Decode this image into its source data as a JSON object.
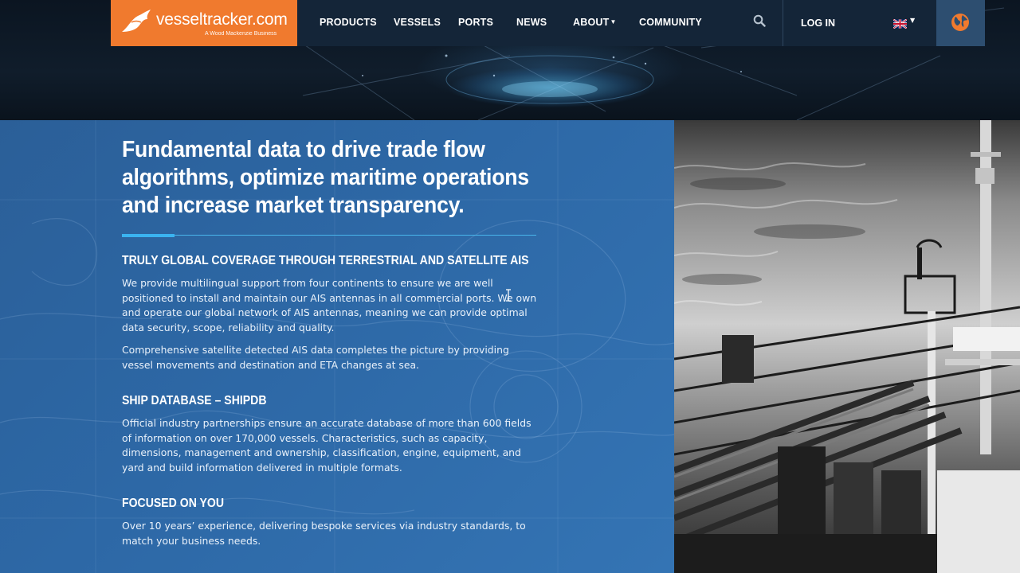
{
  "brand": {
    "name": "vesseltracker.com",
    "tagline": "A Wood Mackenzie Business",
    "color": "#f07a2e"
  },
  "nav": {
    "items": [
      {
        "label": "PRODUCTS"
      },
      {
        "label": "VESSELS"
      },
      {
        "label": "PORTS"
      },
      {
        "label": "NEWS"
      },
      {
        "label": "ABOUT"
      },
      {
        "label": "COMMUNITY"
      }
    ],
    "about_has_dropdown": true,
    "search_icon": "search-icon",
    "login_label": "LOG IN",
    "language_icon": "uk-flag-icon",
    "globe_icon": "globe-icon"
  },
  "main": {
    "headline": "Fundamental data to drive trade flow algorithms, optimize maritime operations and increase market transparency.",
    "sections": [
      {
        "title": "TRULY GLOBAL COVERAGE THROUGH TERRESTRIAL AND SATELLITE AIS",
        "paragraphs": [
          "We provide multilingual support from four continents to ensure we are well positioned to install and maintain our AIS antennas in all commercial ports. We own and operate our global network of AIS antennas, meaning we can provide optimal data security, scope, reliability and quality.",
          "Comprehensive satellite detected AIS data completes the picture by providing vessel movements and destination and ETA changes at sea."
        ]
      },
      {
        "title": "SHIP DATABASE – SHIPDB",
        "paragraphs": [
          "Official industry partnerships ensure an accurate database of more than 600 fields of information on over 170,000 vessels. Characteristics, such as capacity, dimensions, management and ownership, classification, engine, equipment, and yard and build information delivered in multiple formats."
        ]
      },
      {
        "title": "FOCUSED ON YOU",
        "paragraphs": [
          "Over 10 years’ experience, delivering bespoke services via industry standards, to match your business needs."
        ]
      }
    ],
    "accent_color": "#3ab3f0"
  }
}
